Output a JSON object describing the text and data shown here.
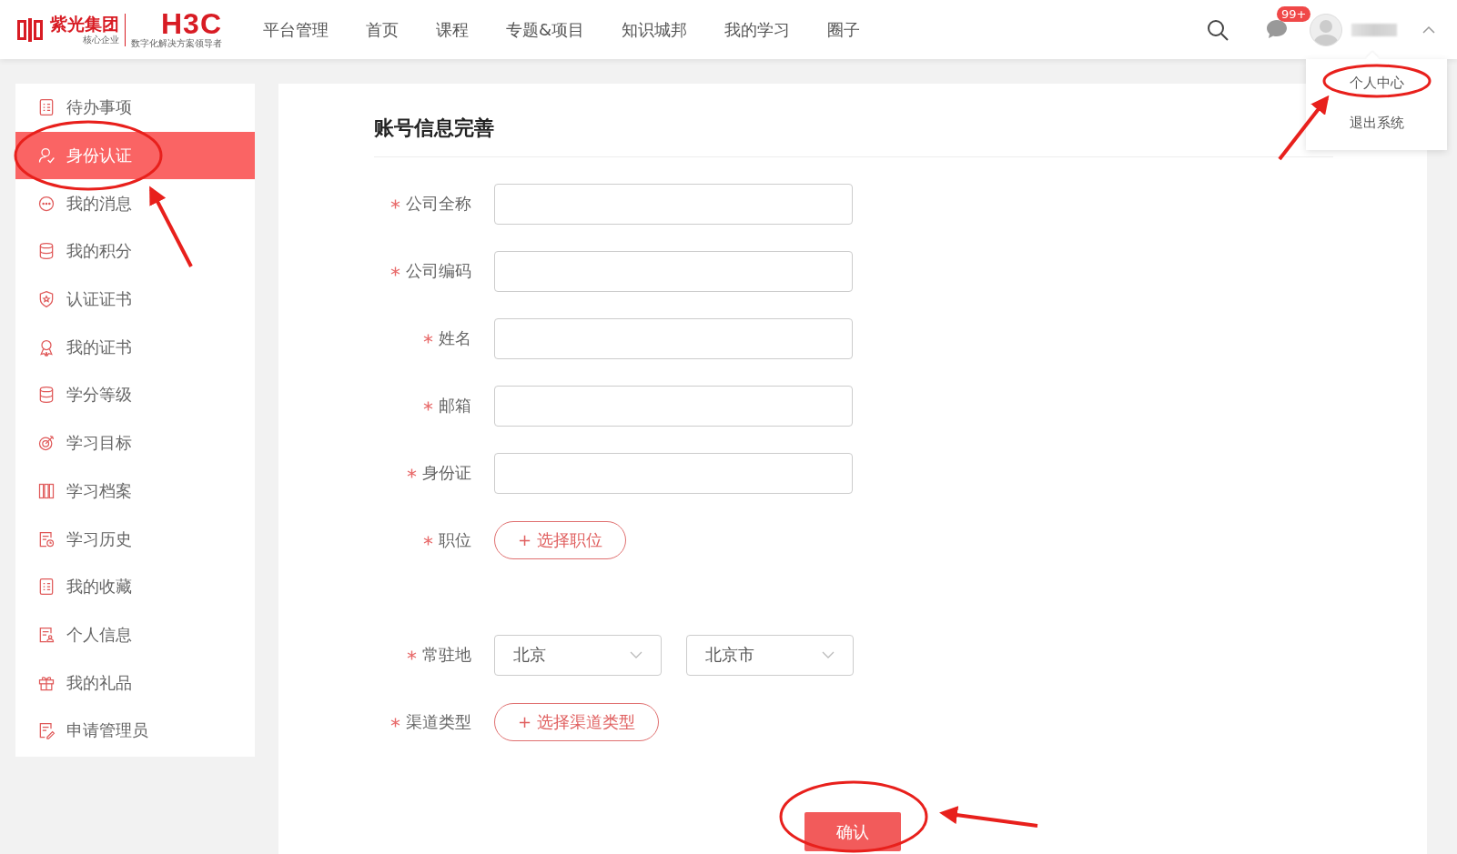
{
  "header": {
    "logo": {
      "name": "紫光集团",
      "tagline": "核心企业",
      "brand": "H3C",
      "slogan": "数字化解决方案领导者"
    },
    "nav": [
      {
        "label": "平台管理"
      },
      {
        "label": "首页"
      },
      {
        "label": "课程"
      },
      {
        "label": "专题&项目"
      },
      {
        "label": "知识城邦"
      },
      {
        "label": "我的学习"
      },
      {
        "label": "圈子"
      }
    ],
    "message_badge": "99+"
  },
  "user_menu": {
    "items": [
      {
        "label": "个人中心"
      },
      {
        "label": "退出系统"
      }
    ]
  },
  "sidebar": {
    "items": [
      {
        "label": "待办事项",
        "kind": "list",
        "selected": false
      },
      {
        "label": "身份认证",
        "kind": "user",
        "selected": true
      },
      {
        "label": "我的消息",
        "kind": "chat",
        "selected": false
      },
      {
        "label": "我的积分",
        "kind": "database",
        "selected": false
      },
      {
        "label": "认证证书",
        "kind": "shield",
        "selected": false
      },
      {
        "label": "我的证书",
        "kind": "medal",
        "selected": false
      },
      {
        "label": "学分等级",
        "kind": "database",
        "selected": false
      },
      {
        "label": "学习目标",
        "kind": "target",
        "selected": false
      },
      {
        "label": "学习档案",
        "kind": "books",
        "selected": false
      },
      {
        "label": "学习历史",
        "kind": "history",
        "selected": false
      },
      {
        "label": "我的收藏",
        "kind": "list",
        "selected": false
      },
      {
        "label": "个人信息",
        "kind": "profile",
        "selected": false
      },
      {
        "label": "我的礼品",
        "kind": "gift",
        "selected": false
      },
      {
        "label": "申请管理员",
        "kind": "apply",
        "selected": false
      }
    ]
  },
  "form": {
    "title": "账号信息完善",
    "fields": [
      {
        "label": "公司全称",
        "required": true,
        "kind": "text"
      },
      {
        "label": "公司编码",
        "required": true,
        "kind": "text"
      },
      {
        "label": "姓名",
        "required": true,
        "kind": "text"
      },
      {
        "label": "邮箱",
        "required": true,
        "kind": "text"
      },
      {
        "label": "身份证",
        "required": true,
        "kind": "text"
      },
      {
        "label": "职位",
        "required": true,
        "kind": "picker",
        "button": "+ 选择职位"
      },
      {
        "label": "常驻地",
        "required": true,
        "kind": "selects",
        "values": [
          "北京",
          "北京市"
        ]
      },
      {
        "label": "渠道类型",
        "required": true,
        "kind": "picker",
        "button": "+ 选择渠道类型"
      }
    ],
    "submit": "确认"
  }
}
